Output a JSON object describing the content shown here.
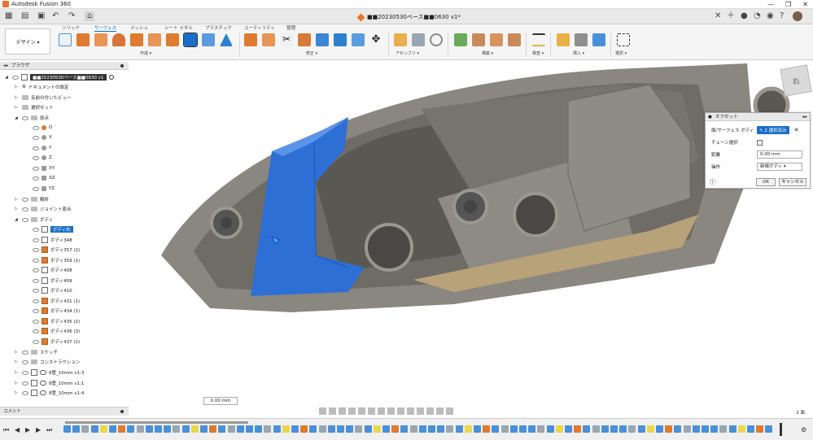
{
  "window": {
    "title": "Autodesk Fusion 360",
    "min": "—",
    "max": "❐",
    "close": "✕"
  },
  "document": {
    "title": "■■20230530ベース■■0630 v1*"
  },
  "workspace": {
    "label": "デザイン ▾"
  },
  "tabs": [
    {
      "label": "ソリッド"
    },
    {
      "label": "サーフェス",
      "active": true
    },
    {
      "label": "メッシュ"
    },
    {
      "label": "シート メタル"
    },
    {
      "label": "プラスチック"
    },
    {
      "label": "ユーティリティ"
    },
    {
      "label": "管理"
    }
  ],
  "groups": [
    {
      "label": "作成 ▾"
    },
    {
      "label": "修正 ▾"
    },
    {
      "label": "アセンブリ ▾"
    },
    {
      "label": "構築 ▾"
    },
    {
      "label": "検査 ▾"
    },
    {
      "label": "挿入 ▾"
    },
    {
      "label": "選択 ▾"
    }
  ],
  "browser": {
    "title": "ブラウザ",
    "root": "■■20230530ベース■■0630 v1",
    "items": [
      {
        "label": "ドキュメントの設定"
      },
      {
        "label": "名前の付いたビュー"
      },
      {
        "label": "選択セット"
      },
      {
        "label": "原点"
      },
      {
        "label": "O"
      },
      {
        "label": "X"
      },
      {
        "label": "Y"
      },
      {
        "label": "Z"
      },
      {
        "label": "XY"
      },
      {
        "label": "XZ"
      },
      {
        "label": "YZ"
      },
      {
        "label": "解析"
      },
      {
        "label": "ジョイント原点"
      },
      {
        "label": "ボディ"
      },
      {
        "label": "ボディ右"
      },
      {
        "label": "ボディ348"
      },
      {
        "label": "ボディ357 (2)"
      },
      {
        "label": "ボディ359 (1)"
      },
      {
        "label": "ボディ408"
      },
      {
        "label": "ボディ409"
      },
      {
        "label": "ボディ410"
      },
      {
        "label": "ボディ431 (1)"
      },
      {
        "label": "ボディ434 (1)"
      },
      {
        "label": "ボディ435 (2)"
      },
      {
        "label": "ボディ436 (3)"
      },
      {
        "label": "ボディ437 (2)"
      },
      {
        "label": "スケッチ"
      },
      {
        "label": "コンストラクション"
      },
      {
        "label": "8管_10mm v1:3"
      },
      {
        "label": "8管_10mm v1:1"
      },
      {
        "label": "8管_10mm v1:4"
      }
    ]
  },
  "offset_panel": {
    "title": "オフセット",
    "face_label": "面/サーフェス ボディ",
    "face_value": "↖ 2 選択済み",
    "chain_label": "チェーン選択",
    "distance_label": "距離",
    "distance_value": "0.00 mm",
    "operation_label": "操作",
    "operation_value": "新規ボディ",
    "ok": "OK",
    "cancel": "キャンセル"
  },
  "viewcube": {
    "label": "右"
  },
  "comment": {
    "label": "コメント"
  },
  "distance_input": {
    "value": "0.00 mm"
  },
  "status": {
    "count": "2 面"
  },
  "colors": {
    "accent": "#1b6fc8",
    "model": "#8a8780",
    "selection": "#2e6fd6",
    "orange": "#e07a2e"
  }
}
